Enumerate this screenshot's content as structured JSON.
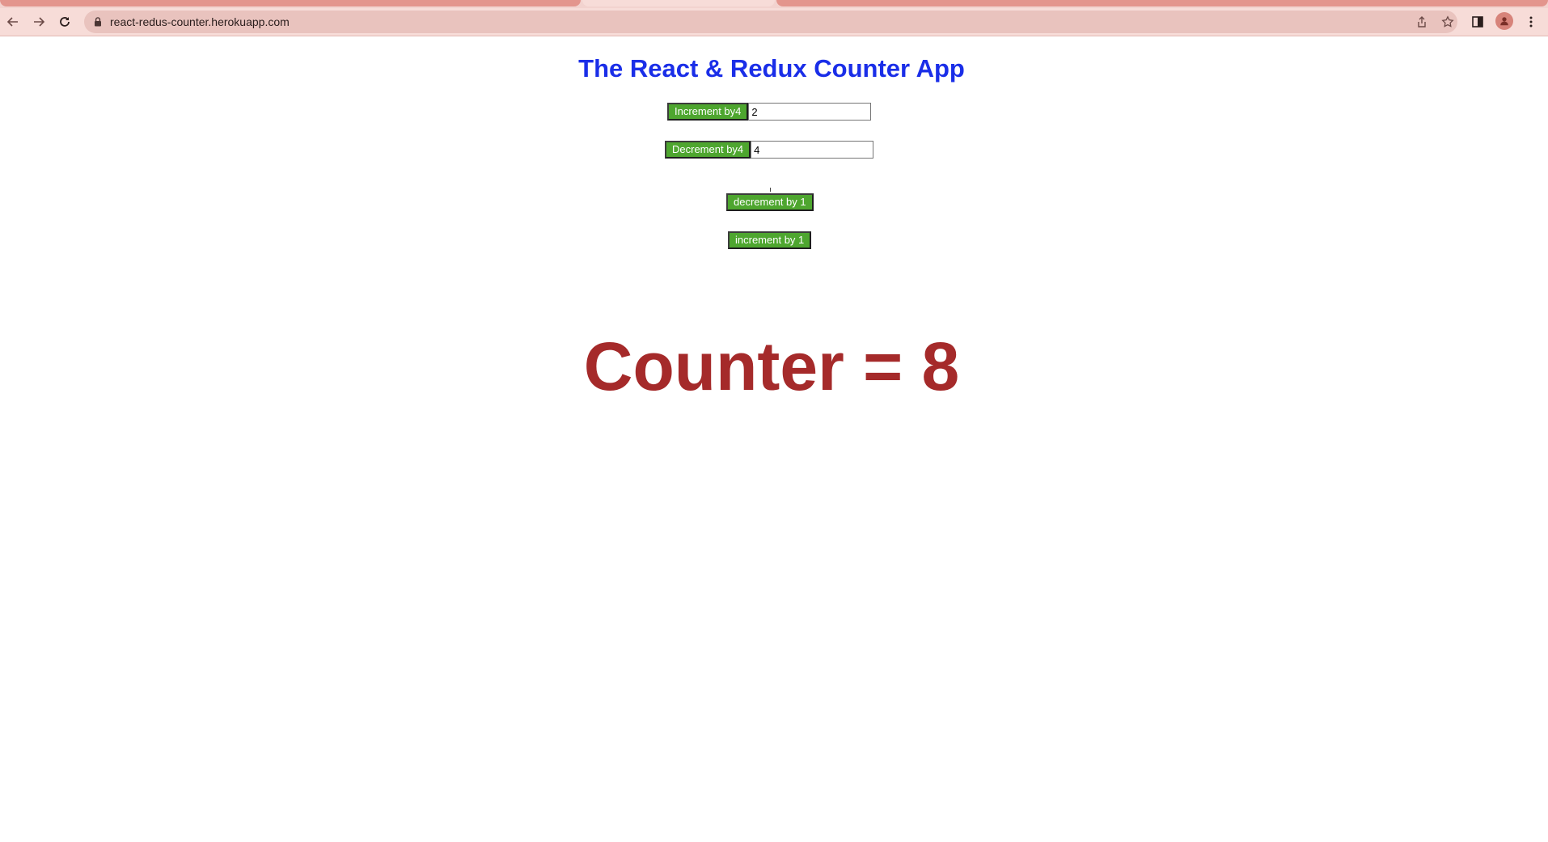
{
  "browser": {
    "url": "react-redus-counter.herokuapp.com"
  },
  "app": {
    "title": "The React & Redux Counter App",
    "increment_by_label": "Increment by4",
    "increment_input_value": "2",
    "decrement_by_label": "Decrement by4",
    "decrement_input_value": "4",
    "decrement_one_label": "decrement by 1",
    "increment_one_label": "increment by 1",
    "counter_text": "Counter = 8"
  },
  "colors": {
    "title": "#1a2ee8",
    "button": "#4ea62f",
    "counter": "#a52a2a",
    "browser_chrome": "#f7dcd8"
  }
}
